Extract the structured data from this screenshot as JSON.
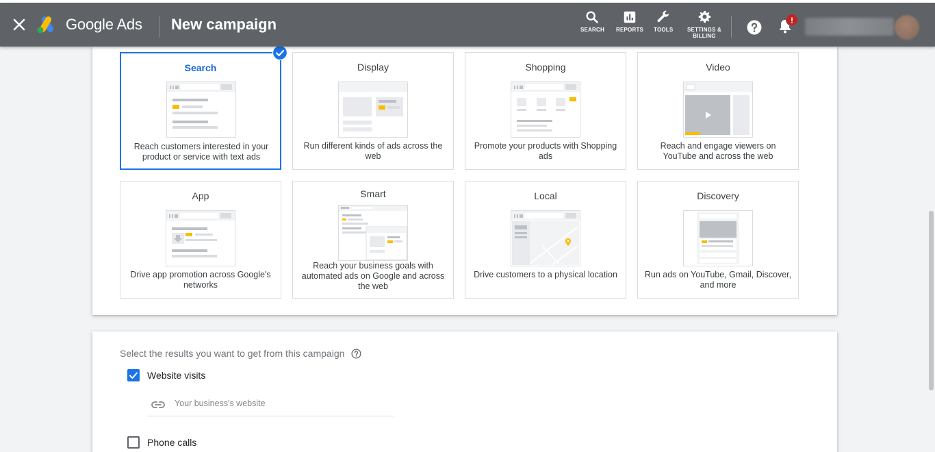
{
  "header": {
    "brand": "Google Ads",
    "title": "New campaign",
    "tools": [
      {
        "label": "SEARCH",
        "icon": "search-icon"
      },
      {
        "label": "REPORTS",
        "icon": "reports-icon"
      },
      {
        "label": "TOOLS",
        "icon": "wrench-icon"
      },
      {
        "label_line1": "SETTINGS &",
        "label_line2": "BILLING",
        "icon": "gear-icon"
      }
    ],
    "notification_badge": "!"
  },
  "campaign_types": [
    {
      "title": "Search",
      "description": "Reach customers interested in your product or service with text ads",
      "selected": true
    },
    {
      "title": "Display",
      "description": "Run different kinds of ads across the web",
      "selected": false
    },
    {
      "title": "Shopping",
      "description": "Promote your products with Shopping ads",
      "selected": false
    },
    {
      "title": "Video",
      "description": "Reach and engage viewers on YouTube and across the web",
      "selected": false
    },
    {
      "title": "App",
      "description": "Drive app promotion across Google's networks",
      "selected": false
    },
    {
      "title": "Smart",
      "description": "Reach your business goals with automated ads on Google and across the web",
      "selected": false
    },
    {
      "title": "Local",
      "description": "Drive customers to a physical location",
      "selected": false
    },
    {
      "title": "Discovery",
      "description": "Run ads on YouTube, Gmail, Discover, and more",
      "selected": false
    }
  ],
  "results": {
    "label": "Select the results you want to get from this campaign",
    "options": [
      {
        "label": "Website visits",
        "checked": true
      },
      {
        "label": "Phone calls",
        "checked": false
      }
    ],
    "website_placeholder": "Your business's website"
  },
  "colors": {
    "topbar": "#5f6368",
    "accent": "#1a73e8",
    "ad_yellow": "#fbbc04"
  }
}
